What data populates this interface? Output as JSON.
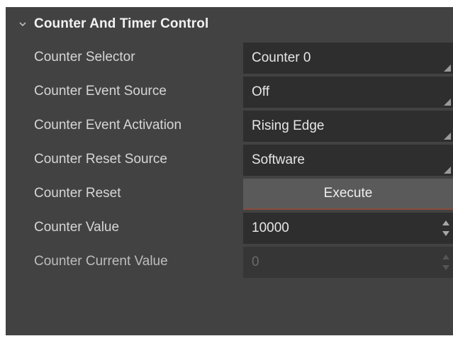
{
  "section": {
    "title": "Counter And Timer Control",
    "chevron_icon": "chevron-down-icon"
  },
  "rows": {
    "counter_selector": {
      "label": "Counter Selector",
      "value": "Counter 0"
    },
    "counter_event_source": {
      "label": "Counter Event Source",
      "value": "Off"
    },
    "counter_event_activation": {
      "label": "Counter Event Activation",
      "value": "Rising Edge"
    },
    "counter_reset_source": {
      "label": "Counter Reset Source",
      "value": "Software"
    },
    "counter_reset": {
      "label": "Counter Reset",
      "button_label": "Execute"
    },
    "counter_value": {
      "label": "Counter Value",
      "value": "10000"
    },
    "counter_current_value": {
      "label": "Counter Current Value",
      "value": "0",
      "disabled": true
    }
  },
  "colors": {
    "panel_background": "#424242",
    "field_background": "#2e2e2e",
    "button_background": "#5a5a5a",
    "button_accent": "#8a4b3c"
  }
}
